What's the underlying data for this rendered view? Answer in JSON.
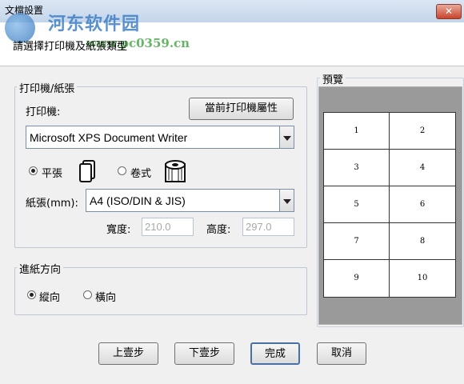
{
  "window": {
    "title": "文檔設置",
    "close_label": "✕"
  },
  "header": {
    "instruction": "請選擇打印機及紙張類型"
  },
  "watermark": {
    "brand": "河东软件园",
    "site": "www.pc0359.cn"
  },
  "printer_group": {
    "legend": "打印機/紙張",
    "printer_label": "打印機:",
    "properties_button": "當前打印機屬性",
    "printer_selected": "Microsoft XPS Document Writer",
    "sheet_label": "平張",
    "roll_label": "卷式",
    "sheet_selected": true,
    "paper_label": "紙張(mm):",
    "paper_selected": "A4 (ISO/DIN & JIS)",
    "width_label": "寬度:",
    "width_value": "210.0",
    "height_label": "高度:",
    "height_value": "297.0"
  },
  "orientation_group": {
    "legend": "進紙方向",
    "portrait_label": "縱向",
    "landscape_label": "橫向",
    "portrait_selected": true
  },
  "preview": {
    "legend": "預覽",
    "cells": [
      "1",
      "2",
      "3",
      "4",
      "5",
      "6",
      "7",
      "8",
      "9",
      "10"
    ]
  },
  "footer": {
    "prev_button": "上壹步",
    "next_button": "下壹步",
    "finish_button": "完成",
    "cancel_button": "取消"
  }
}
